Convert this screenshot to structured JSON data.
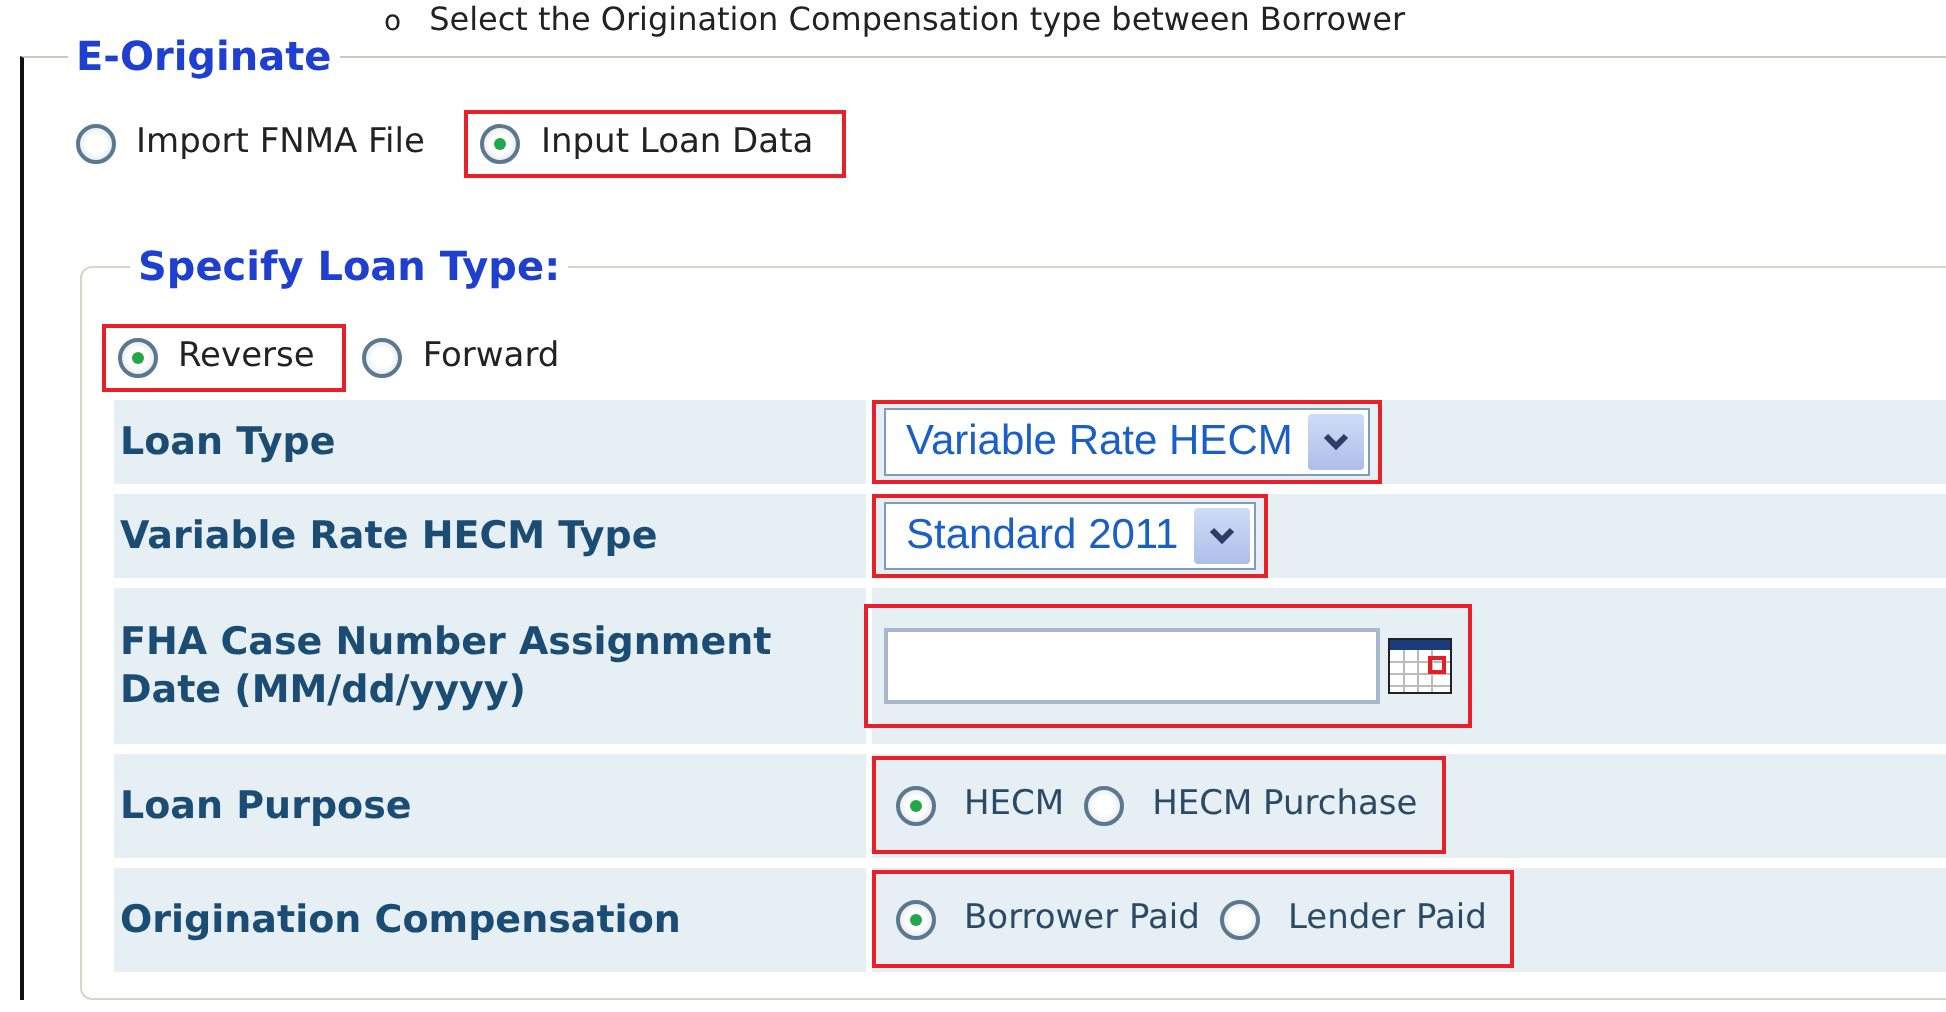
{
  "instruction": {
    "bullet": "o",
    "text": "Select the Origination Compensation type between Borrower"
  },
  "form": {
    "legend": "E-Originate",
    "source_options": [
      {
        "label": "Import FNMA File",
        "selected": false,
        "highlighted": false
      },
      {
        "label": "Input Loan Data",
        "selected": true,
        "highlighted": true
      }
    ],
    "loan_type_section": {
      "legend": "Specify Loan Type:",
      "options": [
        {
          "label": "Reverse",
          "selected": true,
          "highlighted": true
        },
        {
          "label": "Forward",
          "selected": false,
          "highlighted": false
        }
      ],
      "rows": [
        {
          "kind": "select",
          "label": "Loan Type",
          "value": "Variable Rate HECM",
          "highlighted": true
        },
        {
          "kind": "select",
          "label": "Variable Rate HECM Type",
          "value": "Standard 2011",
          "highlighted": true
        },
        {
          "kind": "date",
          "label": "FHA Case Number Assignment Date (MM/dd/yyyy)",
          "highlighted": true
        },
        {
          "kind": "radio",
          "label": "Loan Purpose",
          "highlighted": true,
          "options": [
            {
              "label": "HECM",
              "selected": true
            },
            {
              "label": "HECM Purchase",
              "selected": false
            }
          ]
        },
        {
          "kind": "radio",
          "label": "Origination Compensation",
          "highlighted": true,
          "options": [
            {
              "label": "Borrower Paid",
              "selected": true
            },
            {
              "label": "Lender Paid",
              "selected": false
            }
          ]
        }
      ]
    }
  }
}
